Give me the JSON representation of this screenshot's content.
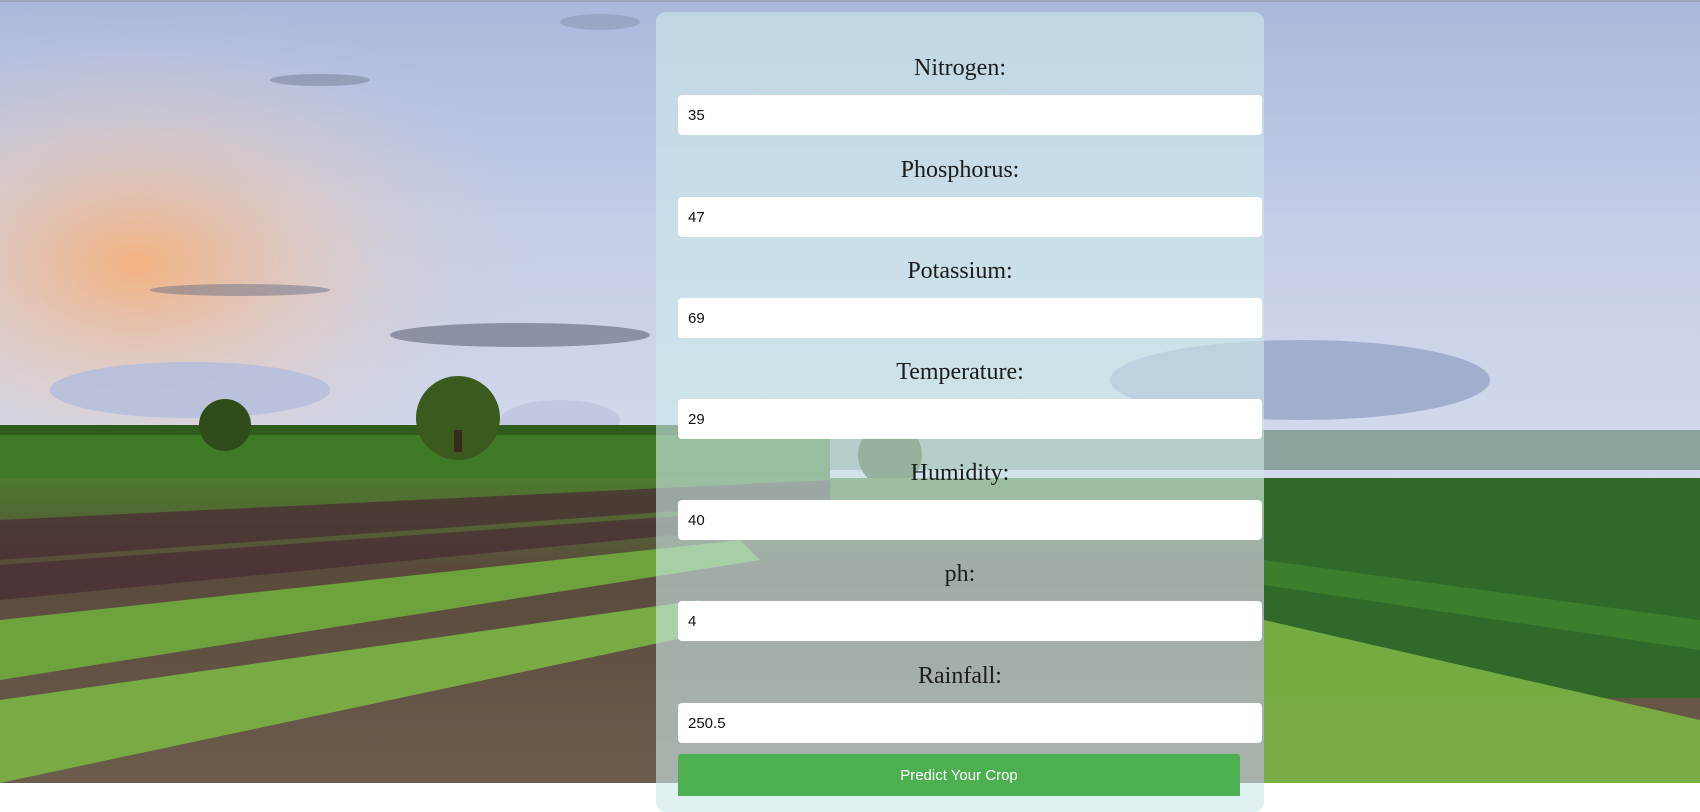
{
  "form": {
    "fields": [
      {
        "label": "Nitrogen:",
        "value": "35"
      },
      {
        "label": "Phosphorus:",
        "value": "47"
      },
      {
        "label": "Potassium:",
        "value": "69"
      },
      {
        "label": "Temperature:",
        "value": "29"
      },
      {
        "label": "Humidity:",
        "value": "40"
      },
      {
        "label": "ph:",
        "value": "4"
      },
      {
        "label": "Rainfall:",
        "value": "250.5"
      }
    ],
    "submit_label": "Predict Your Crop"
  },
  "colors": {
    "button": "#4caf50",
    "card_overlay": "rgba(205,232,232,0.62)"
  }
}
